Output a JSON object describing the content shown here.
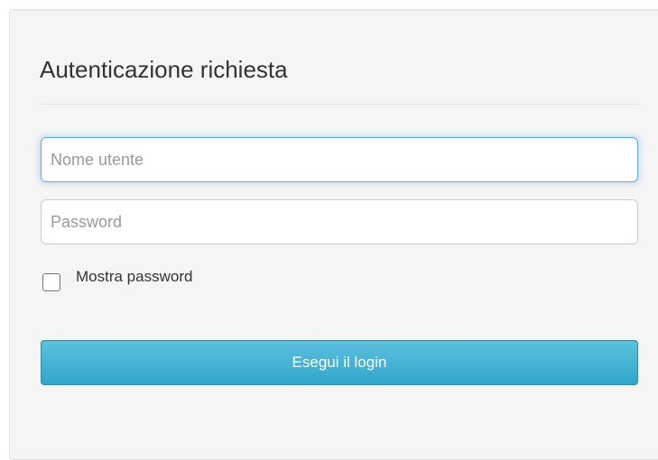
{
  "login": {
    "title": "Autenticazione richiesta",
    "username": {
      "value": "",
      "placeholder": "Nome utente"
    },
    "password": {
      "value": "",
      "placeholder": "Password"
    },
    "show_password": {
      "label": "Mostra password",
      "checked": false
    },
    "submit_label": "Esegui il login"
  },
  "colors": {
    "panel_background": "#f5f5f5",
    "focus_border": "#66afe9",
    "button_top": "#5bc0de",
    "button_bottom": "#31a7cb"
  }
}
